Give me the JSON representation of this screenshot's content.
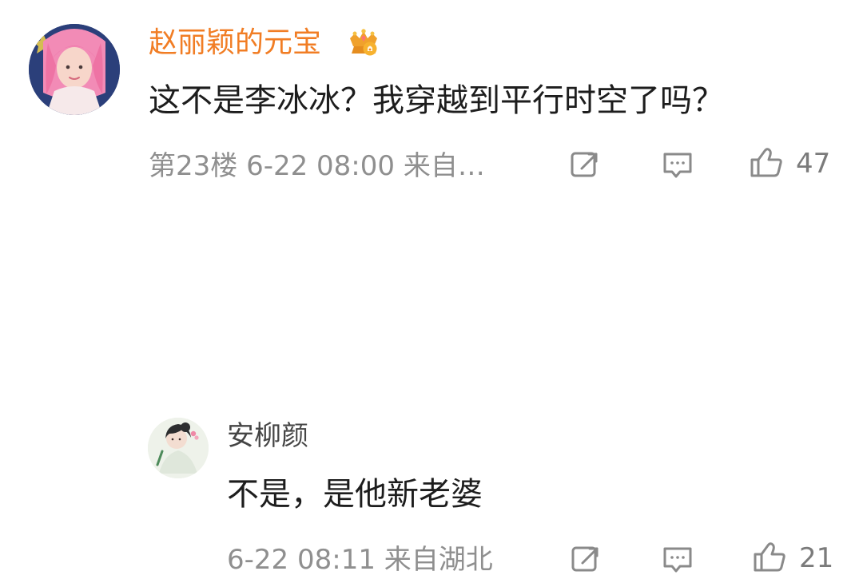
{
  "comment": {
    "username": "赵丽颖的元宝",
    "text": "这不是李冰冰？我穿越到平行时空了吗？",
    "meta": "第23楼 6-22 08:00 来自…",
    "likes": "47"
  },
  "reply": {
    "username": "安柳颜",
    "text": "不是，是他新老婆",
    "meta": "6-22 08:11 来自湖北",
    "likes": "21"
  },
  "colors": {
    "username_orange": "#f17d24",
    "text_primary": "#1d1d1d",
    "text_meta": "#8f8f8f",
    "icon_gray": "#8a8a8a"
  },
  "icons": {
    "share": "share-icon",
    "comment": "comment-icon",
    "like": "thumbs-up-icon",
    "badge": "crown-icon"
  }
}
